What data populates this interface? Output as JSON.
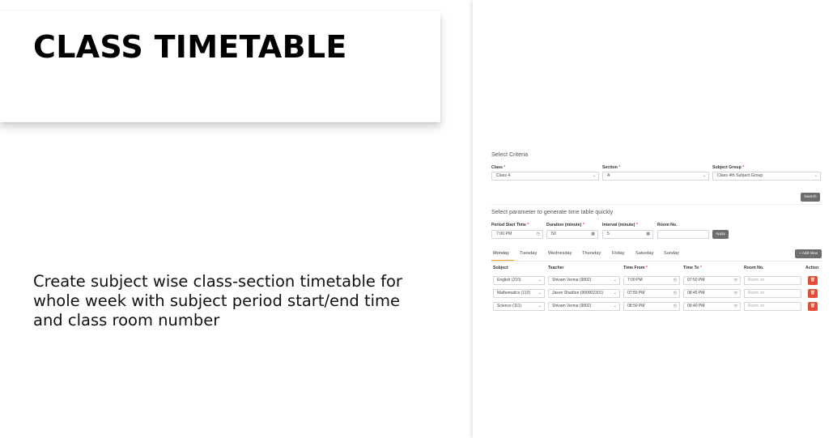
{
  "promo": {
    "title": "CLASS TIMETABLE",
    "description": "Create subject wise class-section timetable for whole week with subject period start/end time and class room number"
  },
  "criteria": {
    "heading": "Select Criteria",
    "class_label": "Class",
    "class_value": "Class 4",
    "section_label": "Section",
    "section_value": "A",
    "subject_group_label": "Subject Group",
    "subject_group_value": "Class 4th Subject Group",
    "required_mark": "*",
    "search_button": "Search"
  },
  "quick": {
    "heading": "Select parameter to generate time table quickly",
    "start_label": "Period Start Time",
    "start_value": "7:00 PM",
    "duration_label": "Duration (minute)",
    "duration_value": "50",
    "interval_label": "Interval (minute)",
    "interval_value": "5",
    "room_label": "Room No.",
    "room_value": "",
    "apply_button": "Apply"
  },
  "tabs": [
    "Monday",
    "Tuesday",
    "Wednesday",
    "Thursday",
    "Friday",
    "Saturday",
    "Sunday"
  ],
  "add_new_button": "+ Add New",
  "table": {
    "headers": {
      "subject": "Subject",
      "teacher": "Teacher",
      "time_from": "Time From",
      "time_to": "Time To",
      "room": "Room No.",
      "action": "Action"
    },
    "room_placeholder": "Room no",
    "rows": [
      {
        "subject": "English (210)",
        "teacher": "Shivam Verma (9002)",
        "from": "7:00 PM",
        "to": "07:50 PM"
      },
      {
        "subject": "Mathematics (110)",
        "teacher": "Jason Sharlton (900002301)",
        "from": "07:55 PM",
        "to": "08:45 PM"
      },
      {
        "subject": "Science (111)",
        "teacher": "Shivam Verma (9002)",
        "from": "08:50 PM",
        "to": "09:40 PM"
      }
    ]
  },
  "icons": {
    "chevron": "chevron-down-icon",
    "clock": "clock-icon",
    "calculator": "calculator-icon",
    "trash": "trash-icon"
  }
}
